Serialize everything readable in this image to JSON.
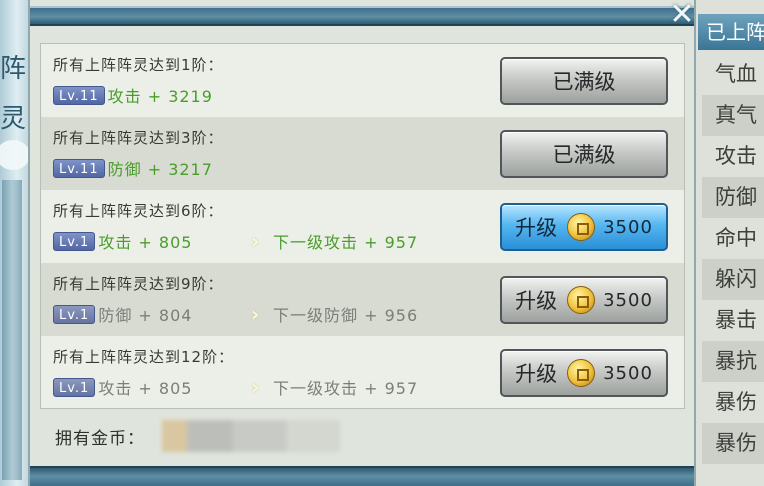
{
  "left_banner": {
    "chars": [
      "阵",
      "灵"
    ]
  },
  "rows": [
    {
      "title": "所有上阵阵灵达到1阶：",
      "level": "Lv.11",
      "attr": "攻击 + 3219",
      "next": "",
      "button": {
        "label": "已满级",
        "cost": ""
      }
    },
    {
      "title": "所有上阵阵灵达到3阶：",
      "level": "Lv.11",
      "attr": "防御 + 3217",
      "next": "",
      "button": {
        "label": "已满级",
        "cost": ""
      }
    },
    {
      "title": "所有上阵阵灵达到6阶：",
      "level": "Lv.1",
      "attr": "攻击 + 805",
      "next": "下一级攻击 + 957",
      "button": {
        "label": "升级",
        "cost": "3500"
      }
    },
    {
      "title": "所有上阵阵灵达到9阶：",
      "level": "Lv.1",
      "attr": "防御 + 804",
      "next": "下一级防御 + 956",
      "button": {
        "label": "升级",
        "cost": "3500"
      }
    },
    {
      "title": "所有上阵阵灵达到12阶：",
      "level": "Lv.1",
      "attr": "攻击 + 805",
      "next": "下一级攻击 + 957",
      "button": {
        "label": "升级",
        "cost": "3500"
      }
    }
  ],
  "footer": {
    "owned_label": "拥有金币："
  },
  "side_panel": {
    "header": "已上阵",
    "items": [
      "气血",
      "真气",
      "攻击",
      "防御",
      "命中",
      "躲闪",
      "暴击",
      "暴抗",
      "暴伤",
      "暴伤"
    ]
  },
  "colors": {
    "accent_green": "#4a9d2c",
    "upgrade_blue": "#55b6f1",
    "bar_blue": "#3f6f89"
  }
}
